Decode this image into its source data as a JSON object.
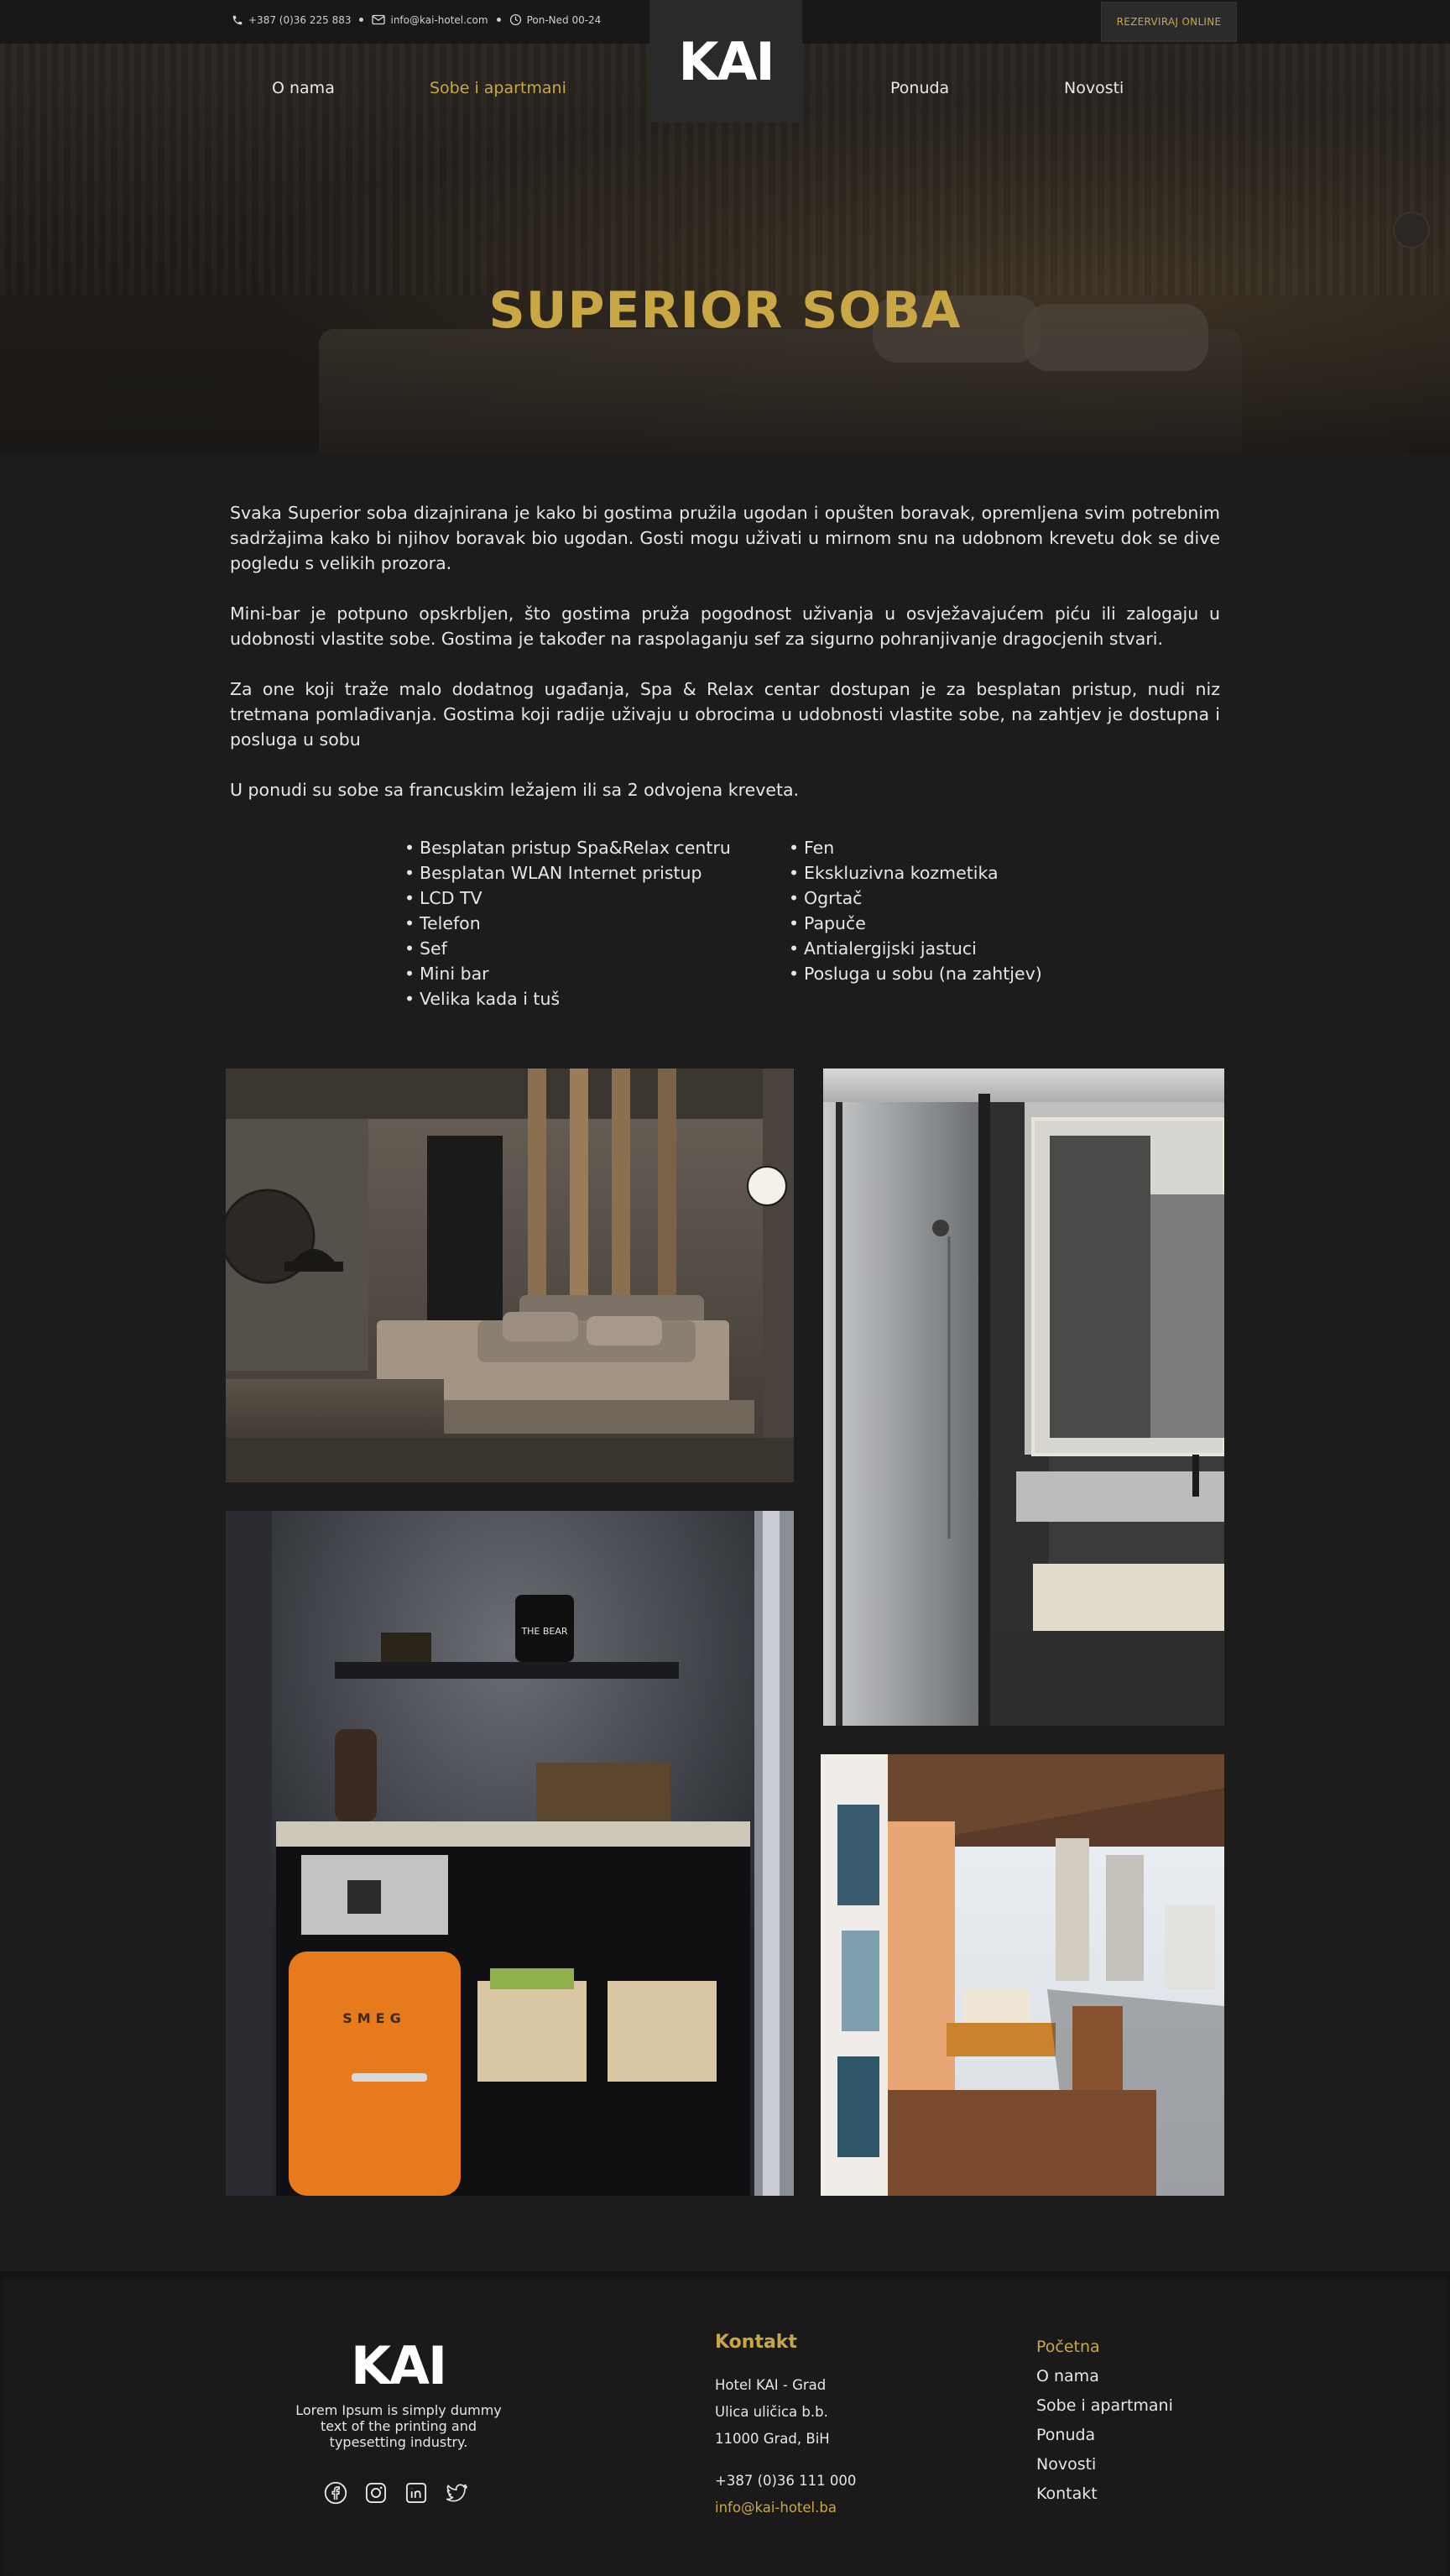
{
  "topbar": {
    "phone": "+387 (0)36 225 883",
    "email": "info@kai-hotel.com",
    "hours": "Pon-Ned 00-24",
    "book_label": "REZERVIRAJ ONLINE"
  },
  "header": {
    "logo": "KAI",
    "nav": [
      "O nama",
      "Sobe i apartmani",
      "Ponuda",
      "Novosti"
    ],
    "active_nav": "Sobe i apartmani"
  },
  "hero": {
    "title": "SUPERIOR SOBA"
  },
  "content": {
    "paragraphs": [
      "Svaka Superior soba dizajnirana je kako bi gostima pružila ugodan i opušten boravak, opremljena svim potrebnim sadržajima kako bi njihov boravak bio ugodan. Gosti mogu uživati u mirnom snu na udobnom krevetu dok se dive pogledu s velikih prozora.",
      "Mini-bar je potpuno opskrbljen, što gostima pruža pogodnost uživanja u osvježavajućem piću ili zalogaju u udobnosti vlastite sobe. Gostima je također na raspolaganju sef za sigurno pohranjivanje dragocjenih stvari.",
      "Za one koji traže malo dodatnog ugađanja, Spa & Relax centar dostupan je za besplatan pristup, nudi niz tretmana pomlađivanja. Gostima koji radije uživaju u obrocima u udobnosti vlastite sobe, na zahtjev je dostupna i posluga u sobu",
      "U ponudi su sobe sa francuskim ležajem ili sa 2 odvojena kreveta."
    ],
    "features_left": [
      "Besplatan pristup Spa&Relax centru",
      "Besplatan WLAN Internet pristup",
      "LCD TV",
      "Telefon",
      "Sef",
      "Mini bar",
      "Velika kada i tuš"
    ],
    "features_right": [
      "Fen",
      "Ekskluzivna kozmetika",
      "Ogrtač",
      "Papuče",
      "Antialergijski jastuci",
      "Posluga u sobu (na zahtjev)"
    ]
  },
  "gallery": {
    "fridge_brand": "SMEG",
    "bucket_label": "THE BEAR"
  },
  "footer": {
    "logo": "KAI",
    "description": "Lorem Ipsum is simply dummy text of the printing and typesetting industry.",
    "social_icons": [
      "facebook-icon",
      "instagram-icon",
      "linkedin-icon",
      "twitter-icon"
    ],
    "contact_heading": "Kontakt",
    "contact_lines": [
      "Hotel KAI - Grad",
      "Ulica uličica b.b.",
      "11000 Grad, BiH"
    ],
    "phone": "+387 (0)36 111 000",
    "email": "info@kai-hotel.ba",
    "links": [
      "Početna",
      "O nama",
      "Sobe i apartmani",
      "Ponuda",
      "Novosti",
      "Kontakt"
    ]
  },
  "colors": {
    "accent": "#c9a745",
    "background": "#1c1c1c",
    "text": "#e6e6e6"
  }
}
